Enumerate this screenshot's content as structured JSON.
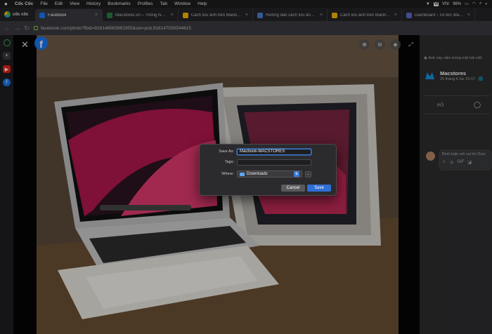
{
  "menubar": {
    "app": "Cốc Cốc",
    "items": [
      "File",
      "Edit",
      "View",
      "History",
      "Bookmarks",
      "Profiles",
      "Tab",
      "Window",
      "Help"
    ],
    "status": {
      "input": "VI",
      "lang": "VNI",
      "battery": "96%"
    }
  },
  "browser": {
    "brand": "cốc cốc",
    "tabs": [
      {
        "title": "Facebook",
        "favicon_color": "#1877f2",
        "active": true
      },
      {
        "title": "Macstores.vn – Thống NGÀY 2...",
        "favicon_color": "#2a7f3e",
        "active": false
      },
      {
        "title": "Cách lưu ảnh trên MacBook đơ...",
        "favicon_color": "#f4b400",
        "active": false
      },
      {
        "title": "Hướng dẫn cách lưu ảnh trên t...",
        "favicon_color": "#4a7bd0",
        "active": false
      },
      {
        "title": "Cách lưu ảnh trên MacBook cự...",
        "favicon_color": "#f4b400",
        "active": false
      },
      {
        "title": "Dashboard ‹ Tin tức Macstore...",
        "favicon_color": "#5b6bbf",
        "active": false
      }
    ],
    "url": "facebook.com/photo?fbid=916146963881955&set=pcb.916147030544615"
  },
  "sidebar": {
    "items": [
      {
        "name": "coccoc-icon",
        "color": "#3bb54a"
      },
      {
        "name": "add-icon",
        "color": "#555"
      },
      {
        "name": "youtube-icon",
        "color": "#e62117"
      },
      {
        "name": "facebook-icon",
        "color": "#1877f2"
      }
    ]
  },
  "panel": {
    "hint": "Ảnh này nằm trong một bài viết",
    "page_name": "Macstores",
    "post_date": "25 tháng 6 lúc 19:17 · 🌐",
    "comment_placeholder": "Bình luận với vai trò Dươ",
    "emoji_icons": [
      "☺",
      "◎",
      "GIF",
      "◪"
    ]
  },
  "dialog": {
    "save_as_label": "Save As:",
    "save_as_value": "Macbook-MACSTORES",
    "tags_label": "Tags:",
    "tags_value": "",
    "where_label": "Where:",
    "where_value": "Downloads",
    "cancel_label": "Cancel",
    "save_label": "Save",
    "accent": "#2f6fd6"
  }
}
